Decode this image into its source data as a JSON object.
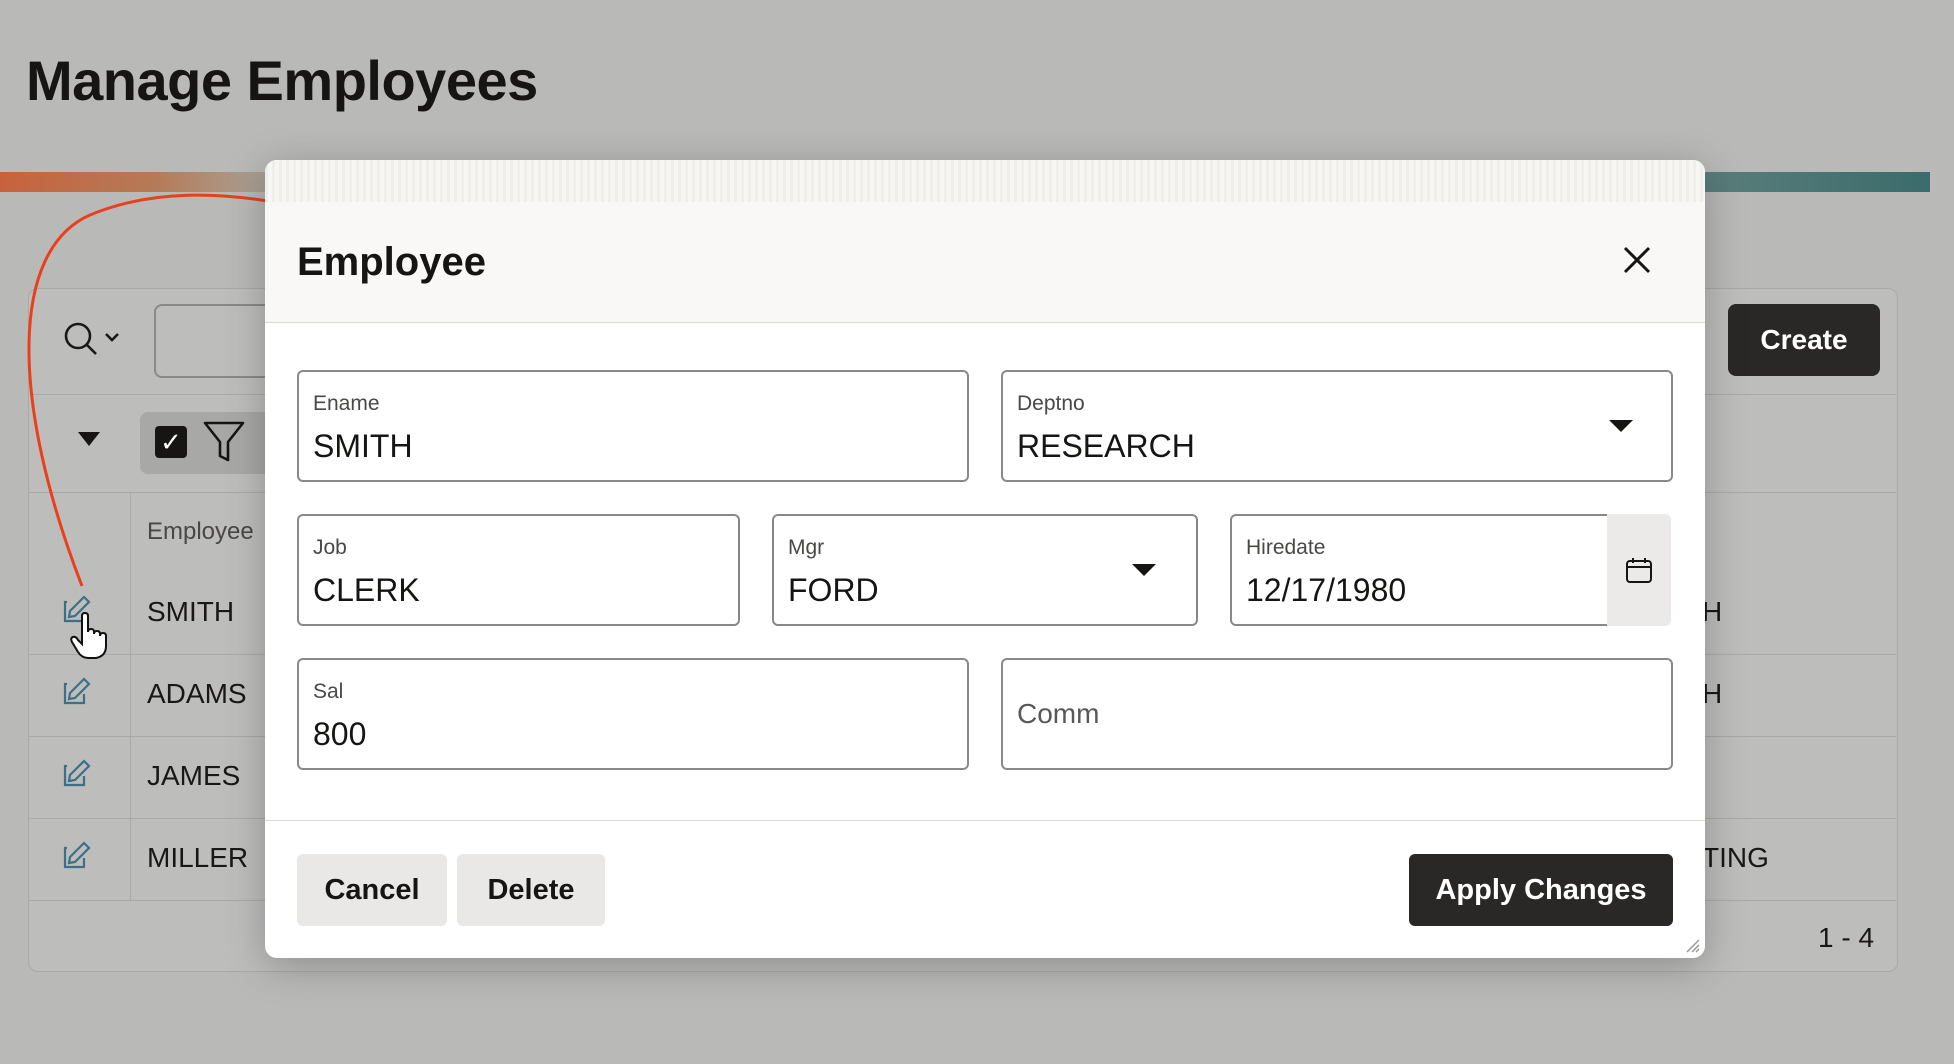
{
  "page": {
    "title": "Manage Employees"
  },
  "report": {
    "create_label": "Create",
    "column_header": "Employee",
    "rows": [
      {
        "name": "SMITH",
        "right": "H"
      },
      {
        "name": "ADAMS",
        "right": "H"
      },
      {
        "name": "JAMES",
        "right": ""
      },
      {
        "name": "MILLER",
        "right": "TING"
      }
    ],
    "pagination": "1 - 4"
  },
  "dialog": {
    "title": "Employee",
    "fields": {
      "ename": {
        "label": "Ename",
        "value": "SMITH"
      },
      "deptno": {
        "label": "Deptno",
        "value": "RESEARCH"
      },
      "job": {
        "label": "Job",
        "value": "CLERK"
      },
      "mgr": {
        "label": "Mgr",
        "value": "FORD"
      },
      "hiredate": {
        "label": "Hiredate",
        "value": "12/17/1980"
      },
      "sal": {
        "label": "Sal",
        "value": "800"
      },
      "comm": {
        "label": "Comm",
        "value": ""
      }
    },
    "buttons": {
      "cancel": "Cancel",
      "delete": "Delete",
      "apply": "Apply Changes"
    }
  },
  "annotation": {
    "arrow_color": "#e8401c"
  }
}
